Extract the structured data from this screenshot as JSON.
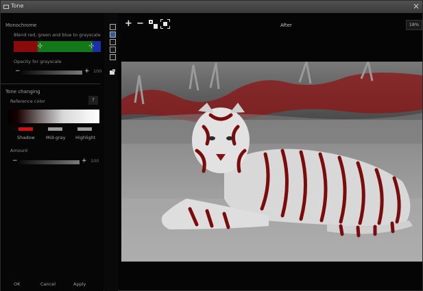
{
  "window": {
    "title": "Tone",
    "close": "×"
  },
  "monochrome": {
    "title": "Monochrome",
    "blend_label": "Blend red, green and blue to grayscale",
    "handle_glyph": "⊹",
    "opacity_label": "Opacity for grayscale",
    "opacity": {
      "minus": "−",
      "plus": "+",
      "value": "100"
    }
  },
  "tone": {
    "title": "Tone changing",
    "reference_label": "Reference color",
    "question_button": "?",
    "swatches": [
      {
        "label": "Shadow",
        "color": "#d41010"
      },
      {
        "label": "Mid-gray",
        "color": "#9a9a9a"
      },
      {
        "label": "Highlight",
        "color": "#9a9a9a"
      }
    ],
    "amount_label": "Amount",
    "amount": {
      "minus": "−",
      "plus": "+",
      "value": "100"
    }
  },
  "buttons": {
    "ok": "OK",
    "cancel": "Cancel",
    "apply": "Apply"
  },
  "toolbar": {
    "zoom_in": "+",
    "zoom_out": "−",
    "actual_size_icon": "actual-size-icon",
    "fit_icon": "fit-screen-icon",
    "view_label": "After",
    "zoom_value": "18%"
  },
  "image": {
    "subject": "tiger",
    "tint": "#b01010"
  }
}
